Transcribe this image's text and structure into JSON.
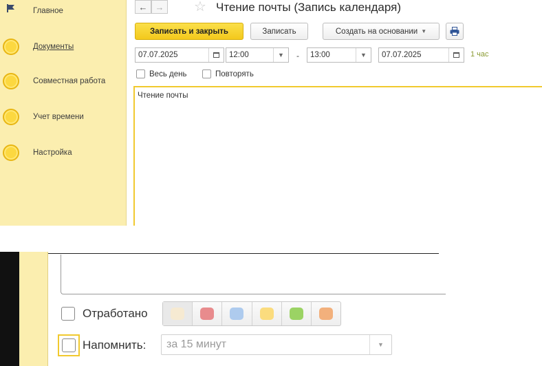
{
  "sidebar": {
    "items": [
      {
        "label": "Главное",
        "icon": "flag-icon"
      },
      {
        "label": "Документы",
        "icon": "circle-icon"
      },
      {
        "label": "Совместная работа",
        "icon": "circle-icon"
      },
      {
        "label": "Учет времени",
        "icon": "circle-icon"
      },
      {
        "label": "Настройка",
        "icon": "circle-icon"
      }
    ]
  },
  "header": {
    "title": "Чтение почты (Запись календаря)",
    "back_icon": "arrow-left-icon",
    "forward_icon": "arrow-right-icon",
    "favorite_icon": "star-icon"
  },
  "toolbar": {
    "save_close_label": "Записать и закрыть",
    "save_label": "Записать",
    "create_based_label": "Создать на основании",
    "print_icon": "printer-icon"
  },
  "schedule": {
    "start_date": "07.07.2025",
    "start_time": "12:00",
    "separator": "-",
    "end_time": "13:00",
    "end_date": "07.07.2025",
    "duration": "1 час"
  },
  "options": {
    "all_day_label": "Весь день",
    "repeat_label": "Повторять"
  },
  "body": {
    "text": "Чтение почты"
  },
  "bottom": {
    "worked_label": "Отработано",
    "remind_label": "Напомнить:",
    "remind_value": "за 15 минут",
    "colors": [
      "#f6ead2",
      "#e88b8d",
      "#aecbee",
      "#fbdc7e",
      "#9bd364",
      "#f2b07c"
    ]
  }
}
